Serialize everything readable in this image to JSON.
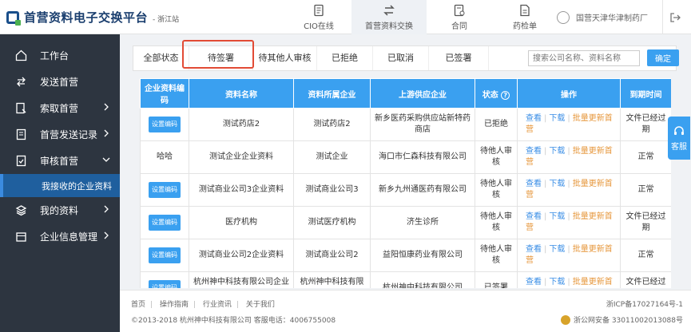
{
  "header": {
    "title": "首营资料电子交换平台",
    "subtitle": "- 浙江站",
    "nav": [
      {
        "label": "CIO在线",
        "icon": "document-icon"
      },
      {
        "label": "首营资料交换",
        "icon": "exchange-icon"
      },
      {
        "label": "合同",
        "icon": "contract-icon"
      },
      {
        "label": "药检单",
        "icon": "report-icon"
      }
    ],
    "user_name": "国营天津华津制药厂"
  },
  "sidebar": {
    "items": [
      {
        "label": "工作台",
        "icon": "home-icon"
      },
      {
        "label": "发送首营",
        "icon": "send-icon"
      },
      {
        "label": "索取首营",
        "icon": "request-icon"
      },
      {
        "label": "首营发送记录",
        "icon": "record-icon"
      },
      {
        "label": "审核首营",
        "icon": "audit-icon"
      },
      {
        "label": "我的资料",
        "icon": "layers-icon"
      },
      {
        "label": "企业信息管理",
        "icon": "company-icon"
      }
    ],
    "active_sub": "我接收的企业资料"
  },
  "tabs": [
    "全部状态",
    "待签署",
    "待其他人审核",
    "已拒绝",
    "已取消",
    "已签署"
  ],
  "search": {
    "placeholder": "搜索公司名称、资料名称",
    "button": "确定"
  },
  "table": {
    "headers": [
      "企业资料编码",
      "资料名称",
      "资料所属企业",
      "上游供应企业",
      "状态",
      "操作",
      "到期时间"
    ],
    "set_code_label": "设置编码",
    "op_view": "查看",
    "op_download": "下载",
    "op_batch": "批量更新首营",
    "rows": [
      {
        "code": "",
        "name": "测试药店2",
        "owner": "测试药店2",
        "supplier": "新乡医药采购供应站新特药商店",
        "status": "已拒绝",
        "expire": "文件已经过期"
      },
      {
        "code": "哈哈",
        "name": "测试企业企业资料",
        "owner": "测试企业",
        "supplier": "海口市仁森科技有限公司",
        "status": "待他人审核",
        "expire": "正常"
      },
      {
        "code": "",
        "name": "测试商业公司3企业资料",
        "owner": "测试商业公司3",
        "supplier": "新乡九州通医药有限公司",
        "status": "待他人审核",
        "expire": "正常"
      },
      {
        "code": "",
        "name": "医疗机构",
        "owner": "测试医疗机构",
        "supplier": "济生诊所",
        "status": "待他人审核",
        "expire": "文件已经过期"
      },
      {
        "code": "",
        "name": "测试商业公司2企业资料",
        "owner": "测试商业公司2",
        "supplier": "益阳恒康药业有限公司",
        "status": "待他人审核",
        "expire": "正常"
      },
      {
        "code": "",
        "name": "杭州神中科技有限公司企业资料",
        "owner": "杭州神中科技有限公司",
        "supplier": "杭州神中科技有限公司",
        "status": "已签署",
        "expire": "文件已经过期"
      }
    ]
  },
  "footer": {
    "links": [
      "首页",
      "操作指南",
      "行业资讯",
      "关于我们"
    ],
    "copyright": "©2013-2018 杭州神中科技有限公司 客服电话：4006755008",
    "icp": "浙ICP备17027164号-1",
    "police": "浙公网安备 33011002013088号"
  },
  "service_label": "客服"
}
